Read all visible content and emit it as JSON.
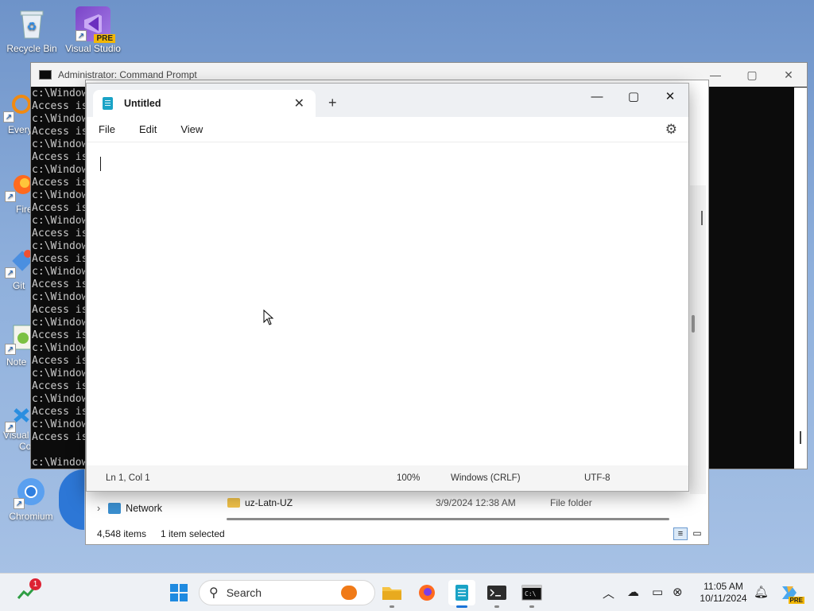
{
  "desktop": {
    "icons": [
      {
        "label": "Recycle Bin",
        "icon": "recycle-bin-icon"
      },
      {
        "label": "Visual Studio",
        "badge": "PRE",
        "icon": "visual-studio-icon"
      },
      {
        "label": "Every",
        "icon": "everything-icon"
      },
      {
        "label": "Fire",
        "icon": "firefox-icon"
      },
      {
        "label": "Git",
        "icon": "git-icon"
      },
      {
        "label": "Note",
        "icon": "notepad-plus-icon"
      },
      {
        "label": "Visual",
        "label2": "Co",
        "icon": "vscode-icon"
      },
      {
        "label": "Chromium",
        "icon": "chromium-icon"
      }
    ]
  },
  "cmd": {
    "title": "Administrator: Command Prompt",
    "lines": [
      "c:\\Window",
      "Access is",
      "c:\\Window",
      "Access is",
      "c:\\Window",
      "Access is",
      "c:\\Window",
      "Access is",
      "c:\\Window",
      "Access is",
      "c:\\Window",
      "Access is",
      "c:\\Window",
      "Access is",
      "c:\\Window",
      "Access is",
      "c:\\Window",
      "Access is",
      "c:\\Window",
      "Access is",
      "c:\\Window",
      "Access is",
      "c:\\Window",
      "Access is",
      "c:\\Window",
      "Access is",
      "c:\\Window",
      "Access is",
      "",
      "c:\\Window"
    ]
  },
  "explorer": {
    "nav_network": "Network",
    "row": {
      "name": "uz-Latn-UZ",
      "date": "3/9/2024 12:38 AM",
      "type": "File folder"
    },
    "status_items": "4,548 items",
    "status_selected": "1 item selected"
  },
  "notepad": {
    "tab_title": "Untitled",
    "menu": [
      "File",
      "Edit",
      "View"
    ],
    "status": {
      "position": "Ln 1, Col 1",
      "zoom": "100%",
      "line_ending": "Windows (CRLF)",
      "encoding": "UTF-8"
    }
  },
  "taskbar": {
    "search_placeholder": "Search",
    "notification_badge": "1",
    "clock_time": "11:05 AM",
    "clock_date": "10/11/2024",
    "copilot_badge": "PRE"
  }
}
